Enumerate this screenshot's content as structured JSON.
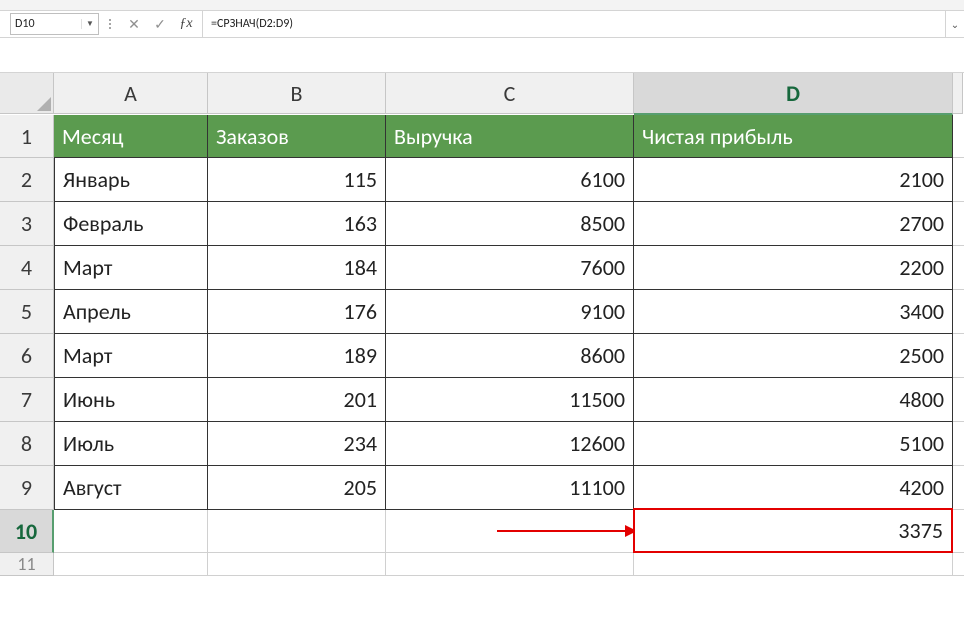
{
  "nameBox": {
    "value": "D10"
  },
  "formulaBar": {
    "formula": "=СРЗНАЧ(D2:D9)"
  },
  "columns": [
    "A",
    "B",
    "C",
    "D"
  ],
  "activeColumn": "D",
  "activeRow": "10",
  "table": {
    "headers": [
      "Месяц",
      "Заказов",
      "Выручка",
      "Чистая прибыль"
    ],
    "rows": [
      {
        "n": "2",
        "month": "Январь",
        "orders": "115",
        "revenue": "6100",
        "profit": "2100"
      },
      {
        "n": "3",
        "month": "Февраль",
        "orders": "163",
        "revenue": "8500",
        "profit": "2700"
      },
      {
        "n": "4",
        "month": "Март",
        "orders": "184",
        "revenue": "7600",
        "profit": "2200"
      },
      {
        "n": "5",
        "month": "Апрель",
        "orders": "176",
        "revenue": "9100",
        "profit": "3400"
      },
      {
        "n": "6",
        "month": "Март",
        "orders": "189",
        "revenue": "8600",
        "profit": "2500"
      },
      {
        "n": "7",
        "month": "Июнь",
        "orders": "201",
        "revenue": "11500",
        "profit": "4800"
      },
      {
        "n": "8",
        "month": "Июль",
        "orders": "234",
        "revenue": "12600",
        "profit": "5100"
      },
      {
        "n": "9",
        "month": "Август",
        "orders": "205",
        "revenue": "11100",
        "profit": "4200"
      }
    ],
    "resultRow": {
      "n": "10",
      "month": "",
      "orders": "",
      "revenue": "",
      "profit": "3375"
    }
  },
  "phantomRow": {
    "n": "11"
  },
  "chart_data": {
    "type": "table",
    "title": "",
    "columns": [
      "Месяц",
      "Заказов",
      "Выручка",
      "Чистая прибыль"
    ],
    "rows": [
      [
        "Январь",
        115,
        6100,
        2100
      ],
      [
        "Февраль",
        163,
        8500,
        2700
      ],
      [
        "Март",
        184,
        7600,
        2200
      ],
      [
        "Апрель",
        176,
        9100,
        3400
      ],
      [
        "Март",
        189,
        8600,
        2500
      ],
      [
        "Июнь",
        201,
        11500,
        4800
      ],
      [
        "Июль",
        234,
        12600,
        5100
      ],
      [
        "Август",
        205,
        11100,
        4200
      ]
    ],
    "aggregate": {
      "label": "СРЗНАЧ(Чистая прибыль)",
      "value": 3375
    }
  }
}
